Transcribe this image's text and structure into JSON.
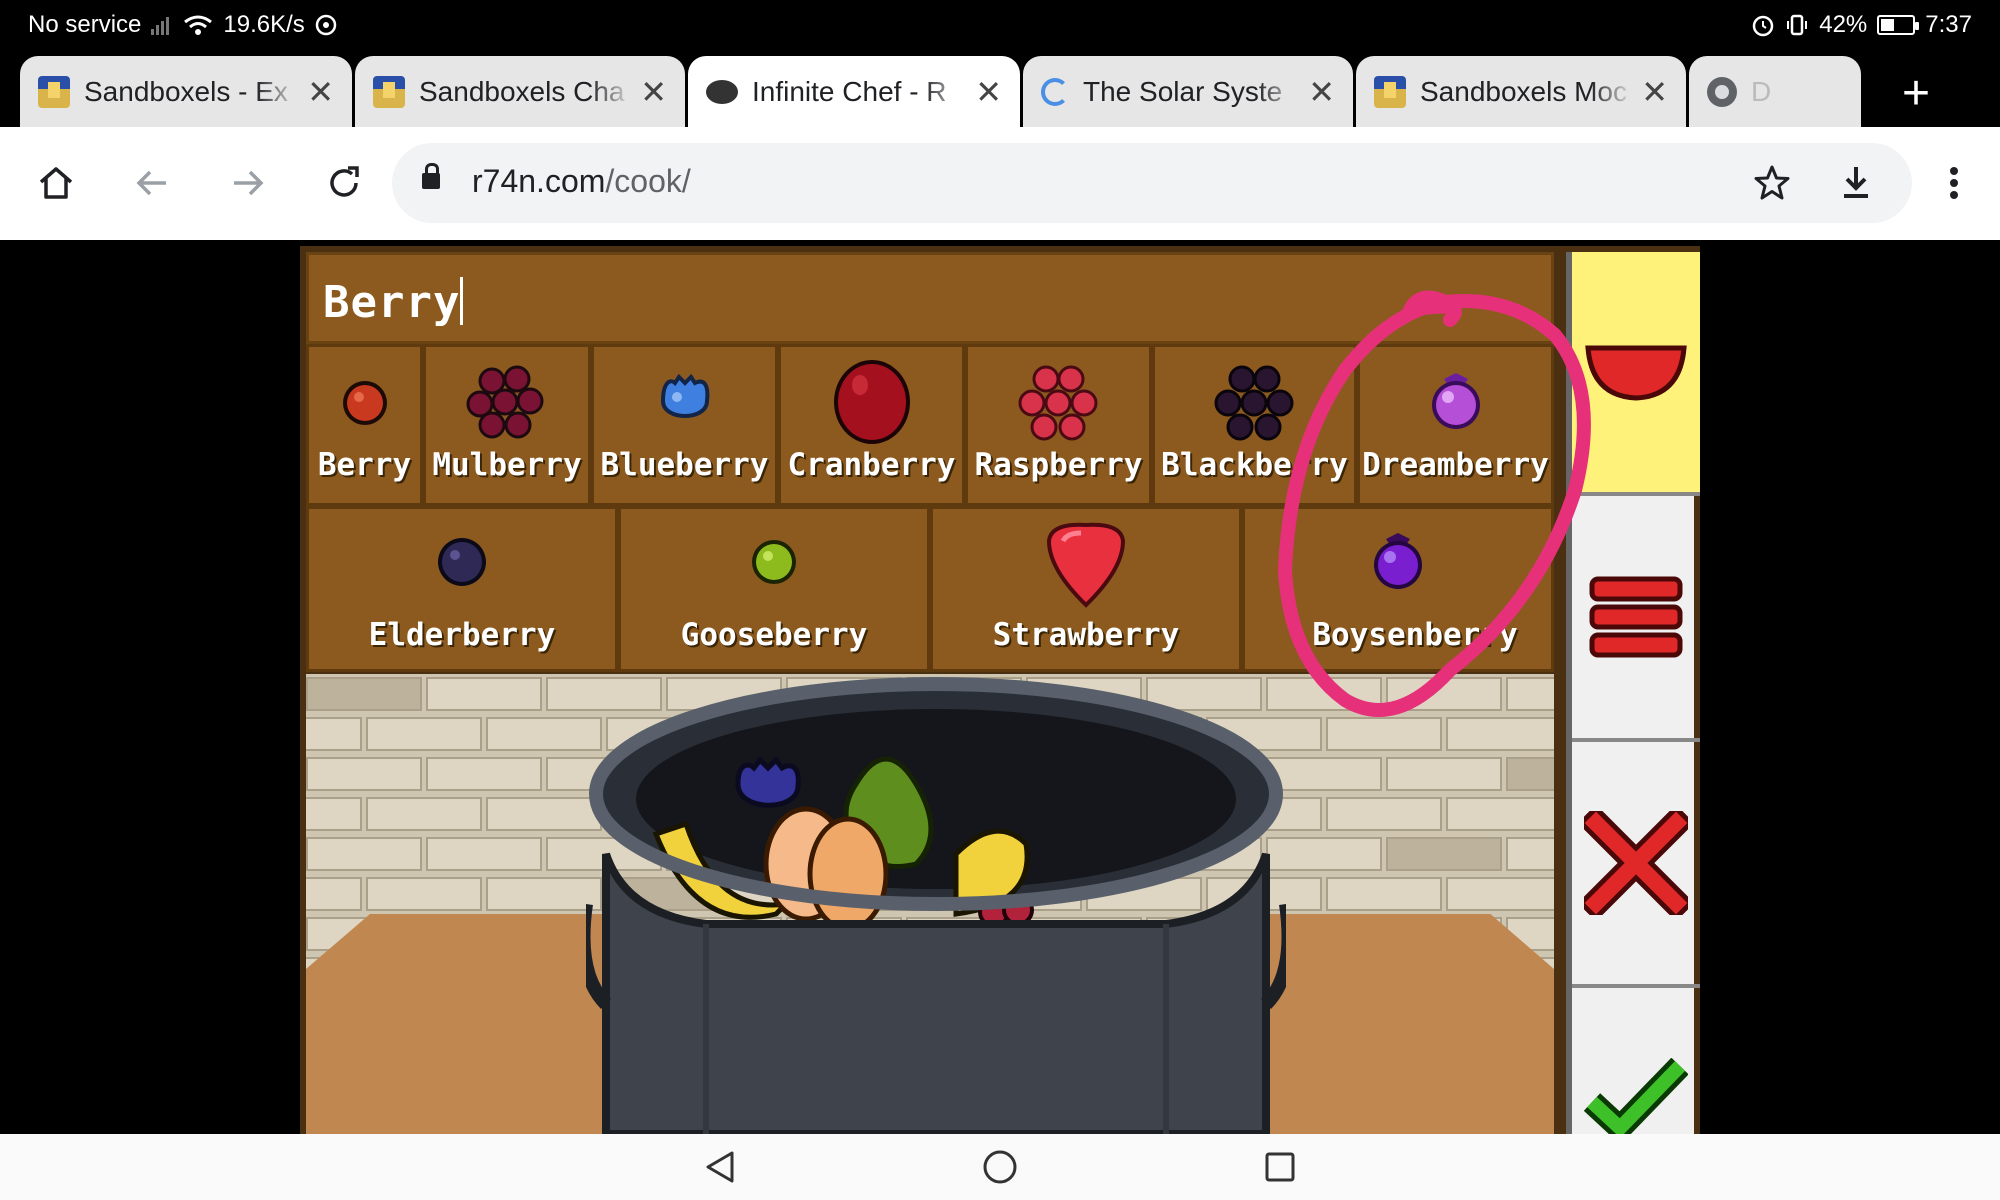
{
  "status_bar": {
    "carrier": "No service",
    "speed": "19.6K/s",
    "battery": "42%",
    "battery_level": 0.42,
    "time": "7:37"
  },
  "tabs": [
    {
      "title": "Sandboxels - Ex",
      "favicon": "sandboxels-icon"
    },
    {
      "title": "Sandboxels Cha",
      "favicon": "sandboxels-icon"
    },
    {
      "title": "Infinite Chef - R",
      "favicon": "pot-icon",
      "active": true
    },
    {
      "title": "The Solar Syste",
      "favicon": "loading-spinner-icon"
    },
    {
      "title": "Sandboxels Moc",
      "favicon": "sandboxels-icon"
    },
    {
      "title": "D",
      "favicon": "chrome-icon"
    }
  ],
  "toolbar": {
    "url_host": "r74n.com",
    "url_path": "/cook/"
  },
  "game": {
    "search_value": "Berry",
    "ingredients_row1": [
      {
        "label": "Berry",
        "icon": "berry-icon",
        "color": "#c9391f"
      },
      {
        "label": "Mulberry",
        "icon": "mulberry-icon",
        "color": "#7a1233"
      },
      {
        "label": "Blueberry",
        "icon": "blueberry-icon",
        "color": "#3e7fe0"
      },
      {
        "label": "Cranberry",
        "icon": "cranberry-icon",
        "color": "#a5101f"
      },
      {
        "label": "Raspberry",
        "icon": "raspberry-icon",
        "color": "#d8334a"
      },
      {
        "label": "Blackberry",
        "icon": "blackberry-icon",
        "color": "#2a1530"
      },
      {
        "label": "Dreamberry",
        "icon": "dreamberry-icon",
        "color": "#b54fd8"
      }
    ],
    "ingredients_row2": [
      {
        "label": "Elderberry",
        "icon": "elderberry-icon",
        "color": "#2e2a55"
      },
      {
        "label": "Gooseberry",
        "icon": "gooseberry-icon",
        "color": "#8dbb1e"
      },
      {
        "label": "Strawberry",
        "icon": "strawberry-icon",
        "color": "#e8303f"
      },
      {
        "label": "Boysenberry",
        "icon": "boysenberry-icon",
        "color": "#7a1fd0"
      }
    ],
    "side_buttons": [
      "bowl-icon",
      "menu-icon",
      "clear-icon",
      "confirm-icon"
    ]
  },
  "colors": {
    "panel_brown": "#8c5a1e",
    "highlight_yellow": "#fff27a",
    "annotation_pink": "#e6307a"
  }
}
